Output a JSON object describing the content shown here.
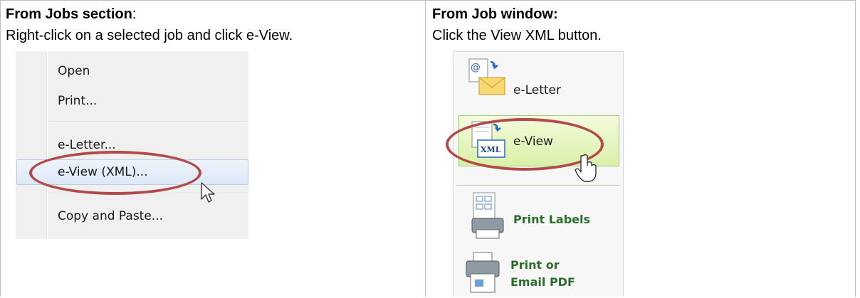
{
  "left": {
    "heading": "From Jobs section",
    "heading_suffix": ":",
    "instruction": "Right-click on a selected job and click e-View.",
    "menu": {
      "items": [
        "Open",
        "Print...",
        "e-Letter...",
        "e-View (XML)...",
        "Copy and Paste..."
      ],
      "highlighted": "e-View (XML)..."
    }
  },
  "right": {
    "heading": "From Job window:",
    "instruction": "Click the View XML button.",
    "ribbon": {
      "eletter": "e-Letter",
      "eview": "e-View",
      "print_labels": "Print Labels",
      "print_email_1": "Print or",
      "print_email_2": "Email PDF"
    }
  },
  "colors": {
    "annotation": "#b24a4a",
    "hover": "#dde8f7",
    "button_highlight": "#d9f0a8"
  }
}
